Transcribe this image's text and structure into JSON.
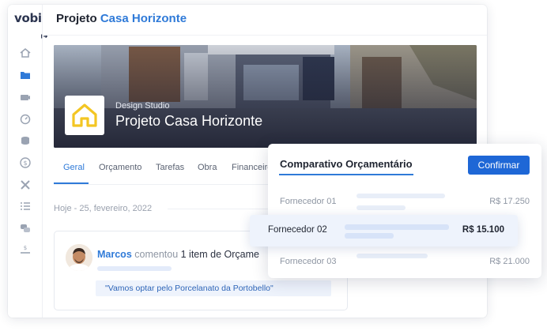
{
  "app": {
    "logo": "vobi",
    "title_prefix": "Projeto ",
    "title_accent": "Casa Horizonte"
  },
  "sidebar": {
    "icons": [
      "home-icon",
      "folder-icon",
      "camera-icon",
      "gauge-icon",
      "coins-icon",
      "dollar-icon",
      "tools-icon",
      "list-icon",
      "chat-icon",
      "money-hand-icon"
    ],
    "collapse_icon": "arrow-right-icon"
  },
  "banner": {
    "studio": "Design Studio",
    "title": "Projeto Casa Horizonte",
    "logo_icon": "house-icon"
  },
  "tabs": [
    {
      "label": "Geral",
      "active": true
    },
    {
      "label": "Orçamento",
      "active": false
    },
    {
      "label": "Tarefas",
      "active": false
    },
    {
      "label": "Obra",
      "active": false
    },
    {
      "label": "Financeiro",
      "active": false
    }
  ],
  "feed": {
    "date": "Hoje - 25, fevereiro, 2022",
    "comment": {
      "author": "Marcos",
      "verb": " comentou",
      "action": " 1 item de Orçame",
      "quote": "\"Vamos optar pelo Porcelanato da Portobello\""
    }
  },
  "comparison": {
    "title": "Comparativo Orçamentário",
    "confirm_label": "Confirmar",
    "suppliers": [
      {
        "name": "Fornecedor 01",
        "price": "R$ 17.250",
        "selected": false
      },
      {
        "name": "Fornecedor 02",
        "price": "R$ 15.100",
        "selected": true
      },
      {
        "name": "Fornecedor 03",
        "price": "R$ 21.000",
        "selected": false
      }
    ]
  },
  "colors": {
    "accent": "#2f7ad8",
    "button": "#1e67d6",
    "house_yellow": "#f3c623"
  }
}
